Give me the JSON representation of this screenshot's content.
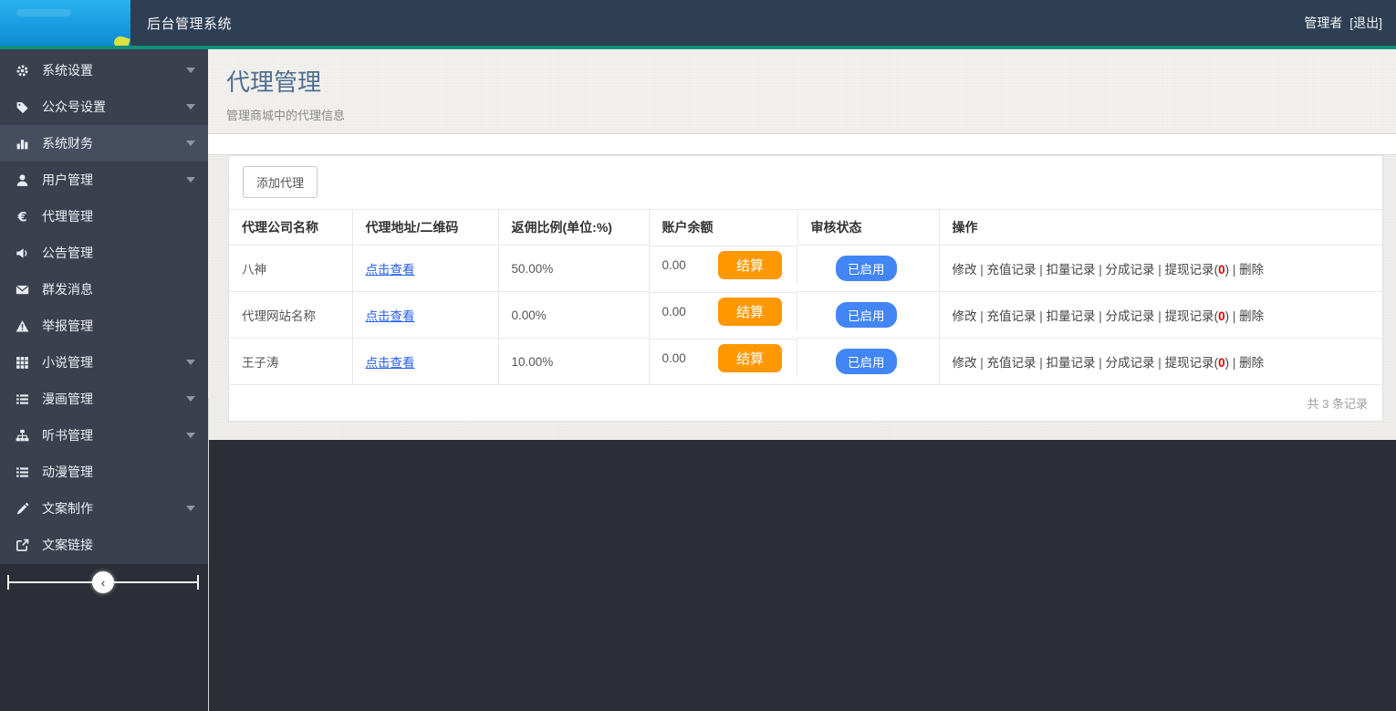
{
  "navbar": {
    "brand": "后台管理系统",
    "user": "管理者",
    "logout": "[退出]"
  },
  "sidebar": {
    "collapse_icon": "‹",
    "items": [
      {
        "label": "系统设置",
        "icon": "gear-icon",
        "expandable": true,
        "active": false
      },
      {
        "label": "公众号设置",
        "icon": "tags-icon",
        "expandable": true,
        "active": false
      },
      {
        "label": "系统财务",
        "icon": "bar-chart-icon",
        "expandable": true,
        "active": true
      },
      {
        "label": "用户管理",
        "icon": "user-icon",
        "expandable": true,
        "active": false
      },
      {
        "label": "代理管理",
        "icon": "euro-icon",
        "expandable": false,
        "active": false
      },
      {
        "label": "公告管理",
        "icon": "megaphone-icon",
        "expandable": false,
        "active": false
      },
      {
        "label": "群发消息",
        "icon": "envelope-icon",
        "expandable": false,
        "active": false
      },
      {
        "label": "举报管理",
        "icon": "warning-icon",
        "expandable": false,
        "active": false
      },
      {
        "label": "小说管理",
        "icon": "grid-icon",
        "expandable": true,
        "active": false
      },
      {
        "label": "漫画管理",
        "icon": "list-icon",
        "expandable": true,
        "active": false
      },
      {
        "label": "听书管理",
        "icon": "sitemap-icon",
        "expandable": true,
        "active": false
      },
      {
        "label": "动漫管理",
        "icon": "list-icon",
        "expandable": false,
        "active": false
      },
      {
        "label": "文案制作",
        "icon": "pen-icon",
        "expandable": true,
        "active": false
      },
      {
        "label": "文案链接",
        "icon": "share-icon",
        "expandable": false,
        "active": false
      }
    ]
  },
  "page": {
    "title": "代理管理",
    "subtitle": "管理商城中的代理信息"
  },
  "toolbar": {
    "add_button": "添加代理"
  },
  "table": {
    "headers": [
      "代理公司名称",
      "代理地址/二维码",
      "返佣比例(单位:%)",
      "账户余额",
      "审核状态",
      "操作"
    ],
    "rows": [
      {
        "name": "八神",
        "view_link": "点击查看",
        "ratio": "50.00%",
        "balance": "0.00",
        "settle_label": "结算",
        "status_label": "已启用",
        "ops": [
          {
            "label": "修改"
          },
          {
            "label": "充值记录"
          },
          {
            "label": "扣量记录"
          },
          {
            "label": "分成记录"
          },
          {
            "label": "提现记录",
            "count": "0"
          },
          {
            "label": "删除"
          }
        ]
      },
      {
        "name": "代理网站名称",
        "view_link": "点击查看",
        "ratio": "0.00%",
        "balance": "0.00",
        "settle_label": "结算",
        "status_label": "已启用",
        "ops": [
          {
            "label": "修改"
          },
          {
            "label": "充值记录"
          },
          {
            "label": "扣量记录"
          },
          {
            "label": "分成记录"
          },
          {
            "label": "提现记录",
            "count": "0"
          },
          {
            "label": "删除"
          }
        ]
      },
      {
        "name": "王子涛",
        "view_link": "点击查看",
        "ratio": "10.00%",
        "balance": "0.00",
        "settle_label": "结算",
        "status_label": "已启用",
        "ops": [
          {
            "label": "修改"
          },
          {
            "label": "充值记录"
          },
          {
            "label": "扣量记录"
          },
          {
            "label": "分成记录"
          },
          {
            "label": "提现记录",
            "count": "0"
          },
          {
            "label": "删除"
          }
        ]
      }
    ],
    "footer": "共 3 条记录"
  },
  "colors": {
    "teal": "#0f917c",
    "navbar": "#2e3f53",
    "settle_orange": "#ff9800",
    "status_blue": "#4285f4",
    "count_red": "#e60000",
    "link_blue": "#2862e9",
    "title_blue": "#4e6e8f"
  }
}
